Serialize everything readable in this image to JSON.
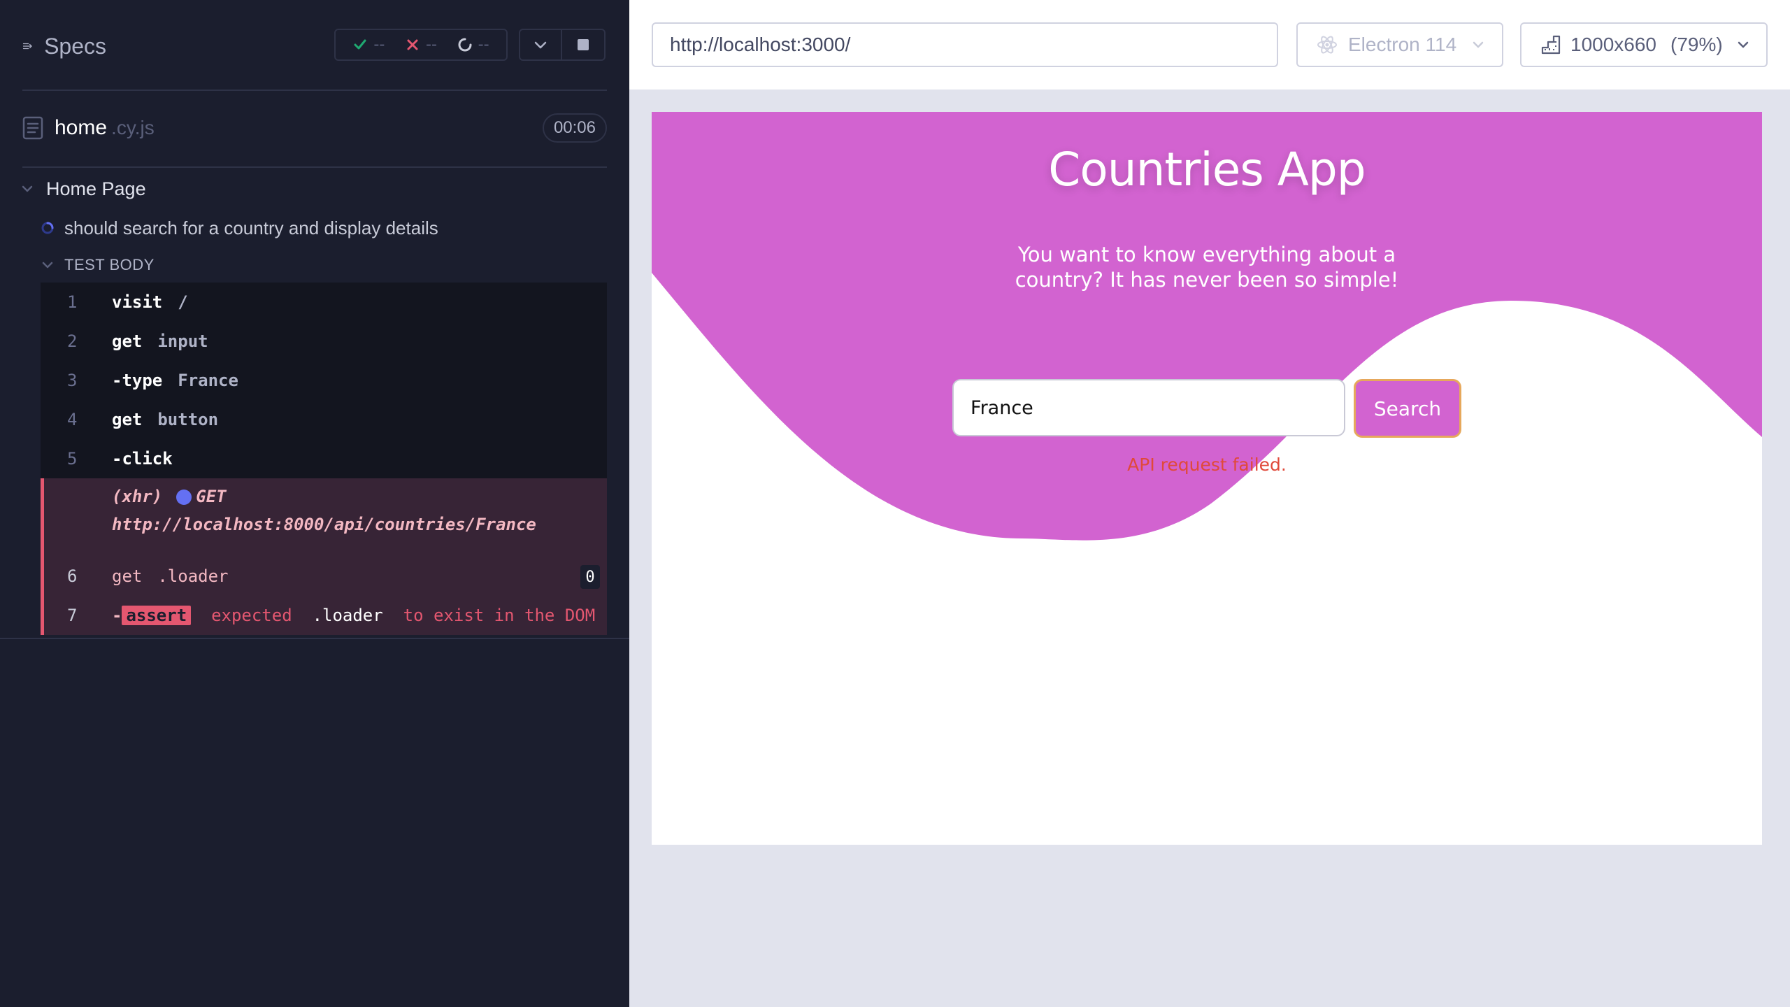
{
  "reporter": {
    "specs_label": "Specs",
    "stats": {
      "passed": "--",
      "failed": "--",
      "pending": "--"
    },
    "file": {
      "name": "home",
      "ext": ".cy.js",
      "duration": "00:06"
    },
    "suite_title": "Home Page",
    "test_title": "should search for a country and display details",
    "test_body_label": "TEST BODY",
    "commands": [
      {
        "num": "1",
        "name": "visit",
        "message": "/"
      },
      {
        "num": "2",
        "name": "get",
        "message": "input"
      },
      {
        "num": "3",
        "name": "-type",
        "message": "France"
      },
      {
        "num": "4",
        "name": "get",
        "message": "button"
      },
      {
        "num": "5",
        "name": "-click",
        "message": ""
      }
    ],
    "xhr": {
      "label": "(xhr)",
      "method": "GET",
      "url": "http://localhost:8000/api/countries/France"
    },
    "cmd6": {
      "num": "6",
      "name": "get",
      "message": ".loader",
      "badge": "0"
    },
    "cmd7": {
      "num": "7",
      "prefix": "-",
      "tag": "assert",
      "w1": "expected",
      "w2": ".loader",
      "w3": "to exist in the DOM"
    }
  },
  "aut": {
    "url": "http://localhost:3000/",
    "browser": "Electron 114",
    "viewport": "1000x660",
    "zoom": "(79%)"
  },
  "app": {
    "title": "Countries App",
    "subtitle": "You want to know everything about a country? It has never been so simple!",
    "search_value": "France",
    "search_button": "Search",
    "error": "API request failed."
  },
  "colors": {
    "accent": "#d263d0",
    "error": "#e0493a",
    "failed_bg": "#372436",
    "failed_border": "#e45770"
  },
  "icons": [
    "specs-list-icon",
    "check-icon",
    "x-icon",
    "spinner-icon",
    "chevron-down-icon",
    "stop-icon",
    "file-icon",
    "electron-icon",
    "ruler-icon"
  ]
}
